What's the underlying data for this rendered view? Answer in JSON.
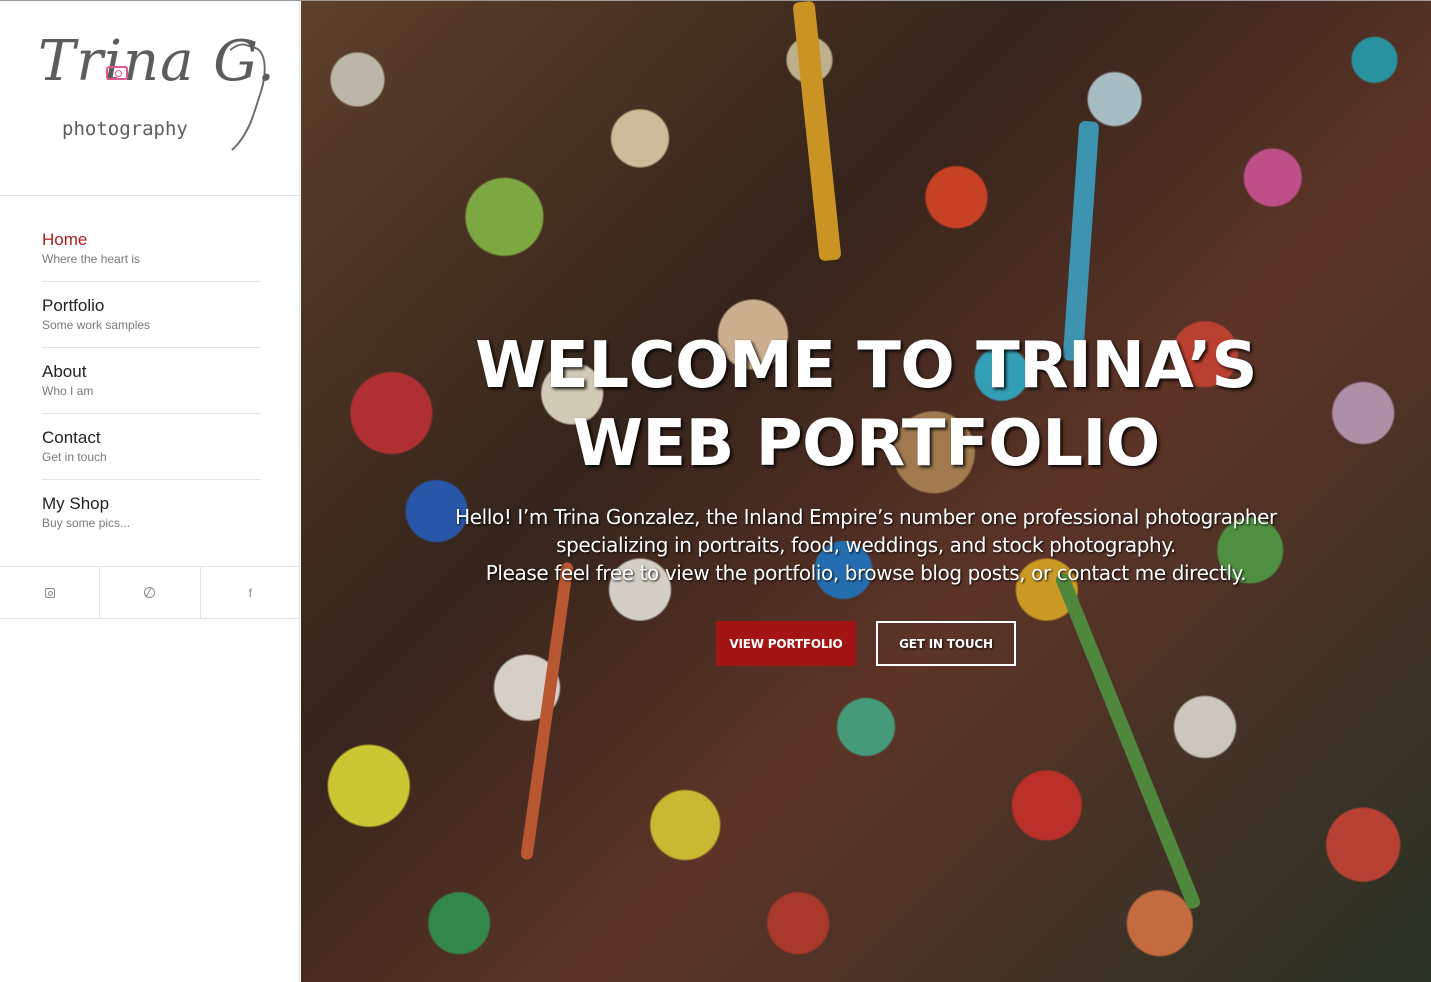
{
  "logo": {
    "script_text": "Trina G.",
    "sub_text": "photography"
  },
  "nav": [
    {
      "title": "Home",
      "subtitle": "Where the heart is",
      "active": true
    },
    {
      "title": "Portfolio",
      "subtitle": "Some work samples",
      "active": false
    },
    {
      "title": "About",
      "subtitle": "Who I am",
      "active": false
    },
    {
      "title": "Contact",
      "subtitle": "Get in touch",
      "active": false
    },
    {
      "title": "My Shop",
      "subtitle": "Buy some pics...",
      "active": false
    }
  ],
  "social": [
    "instagram-icon",
    "dribbble-icon",
    "facebook-icon"
  ],
  "hero": {
    "title": "WELCOME TO TRINA’S WEB PORTFOLIO",
    "intro_line1": "Hello! I’m Trina Gonzalez, the Inland Empire’s number one professional photographer specializing in portraits, food, weddings, and stock photography.",
    "intro_line2": "Please feel free to view the portfolio, browse blog posts, or contact me directly.",
    "primary_button": "VIEW PORTFOLIO",
    "secondary_button": "GET IN TOUCH"
  },
  "colors": {
    "accent": "#b01b1b",
    "button_red": "#a31414",
    "text": "#222222",
    "muted": "#7a7a7a"
  }
}
